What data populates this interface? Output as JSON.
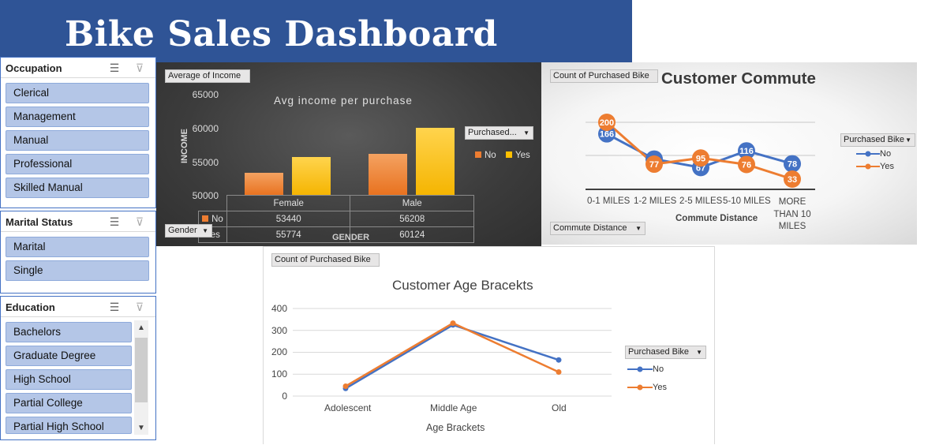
{
  "banner": {
    "title": "Bike Sales Dashboard"
  },
  "slicers": {
    "occupation": {
      "title": "Occupation",
      "items": [
        "Clerical",
        "Management",
        "Manual",
        "Professional",
        "Skilled Manual"
      ]
    },
    "marital": {
      "title": "Marital Status",
      "items": [
        "Marital",
        "Single"
      ]
    },
    "education": {
      "title": "Education",
      "items": [
        "Bachelors",
        "Graduate Degree",
        "High School",
        "Partial College",
        "Partial High School"
      ]
    },
    "icons": {
      "multiselect": "multi-select-icon",
      "clear": "clear-filter-icon"
    }
  },
  "income_chart": {
    "field_value": "Average of Income",
    "field_axis": "Gender",
    "field_legend": "Purchased...",
    "ylabel": "INCOME",
    "xlabel": "GENDER",
    "table_row_no": "No",
    "table_row_yes": "Yes",
    "legend_no": "No",
    "legend_yes": "Yes",
    "colors": {
      "No": "#ed7d31",
      "Yes": "#ffc000"
    }
  },
  "commute_chart": {
    "field_value": "Count of Purchased Bike",
    "field_axis": "Commute Distance",
    "legend_title": "Purchased Bike",
    "legend_no": "No",
    "legend_yes": "Yes",
    "colors": {
      "No": "#4472c4",
      "Yes": "#ed7d31"
    }
  },
  "age_chart": {
    "field_value": "Count of Purchased Bike",
    "legend_title": "Purchased Bike",
    "legend_no": "No",
    "legend_yes": "Yes",
    "colors": {
      "No": "#4472c4",
      "Yes": "#ed7d31"
    }
  },
  "chart_data": [
    {
      "type": "bar",
      "title": "Avg income per purchase",
      "xlabel": "GENDER",
      "ylabel": "INCOME",
      "categories": [
        "Female",
        "Male"
      ],
      "series": [
        {
          "name": "No",
          "values": [
            53440,
            56208
          ]
        },
        {
          "name": "Yes",
          "values": [
            55774,
            60124
          ]
        }
      ],
      "yticks": [
        "65000",
        "60000",
        "55000",
        "50000"
      ],
      "ylim": [
        50000,
        65000
      ],
      "legend": "right"
    },
    {
      "type": "line",
      "title": "Customer Commute",
      "xlabel": "Commute Distance",
      "categories": [
        "0-1 MILES",
        "1-2 MILES",
        "2-5 MILES",
        "5-10 MILES",
        "MORE THAN 10 MILES"
      ],
      "series": [
        {
          "name": "No",
          "values": [
            166,
            92,
            67,
            116,
            78
          ]
        },
        {
          "name": "Yes",
          "values": [
            200,
            77,
            95,
            76,
            33
          ]
        }
      ],
      "legend": "right"
    },
    {
      "type": "line",
      "title": "Customer Age Bracekts",
      "xlabel": "Age Brackets",
      "categories": [
        "Adolescent",
        "Middle Age",
        "Old"
      ],
      "series": [
        {
          "name": "No",
          "values": [
            35,
            325,
            165
          ]
        },
        {
          "name": "Yes",
          "values": [
            45,
            333,
            110
          ]
        }
      ],
      "yticks": [
        "400",
        "300",
        "200",
        "100",
        "0"
      ],
      "ylim": [
        0,
        400
      ],
      "legend": "right"
    }
  ]
}
